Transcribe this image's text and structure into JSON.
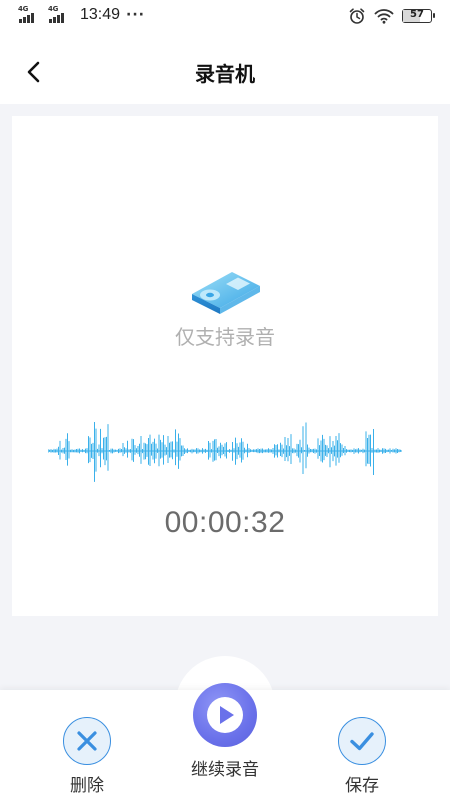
{
  "status_bar": {
    "network_1": "4G",
    "network_2": "4G",
    "time": "13:49",
    "more": "···",
    "battery": "57"
  },
  "header": {
    "title": "录音机"
  },
  "recorder": {
    "support_text": "仅支持录音",
    "elapsed_time": "00:00:32"
  },
  "actions": {
    "delete_label": "删除",
    "continue_label": "继续录音",
    "save_label": "保存"
  },
  "colors": {
    "accent_blue": "#3a8fe0",
    "waveform": "#3ab0ea",
    "play_button": "#6a71ea",
    "background": "#f3f4f8"
  },
  "icons": [
    "back-arrow-icon",
    "music-player-icon",
    "close-icon",
    "play-icon",
    "checkmark-icon",
    "alarm-icon",
    "wifi-icon",
    "battery-icon"
  ]
}
